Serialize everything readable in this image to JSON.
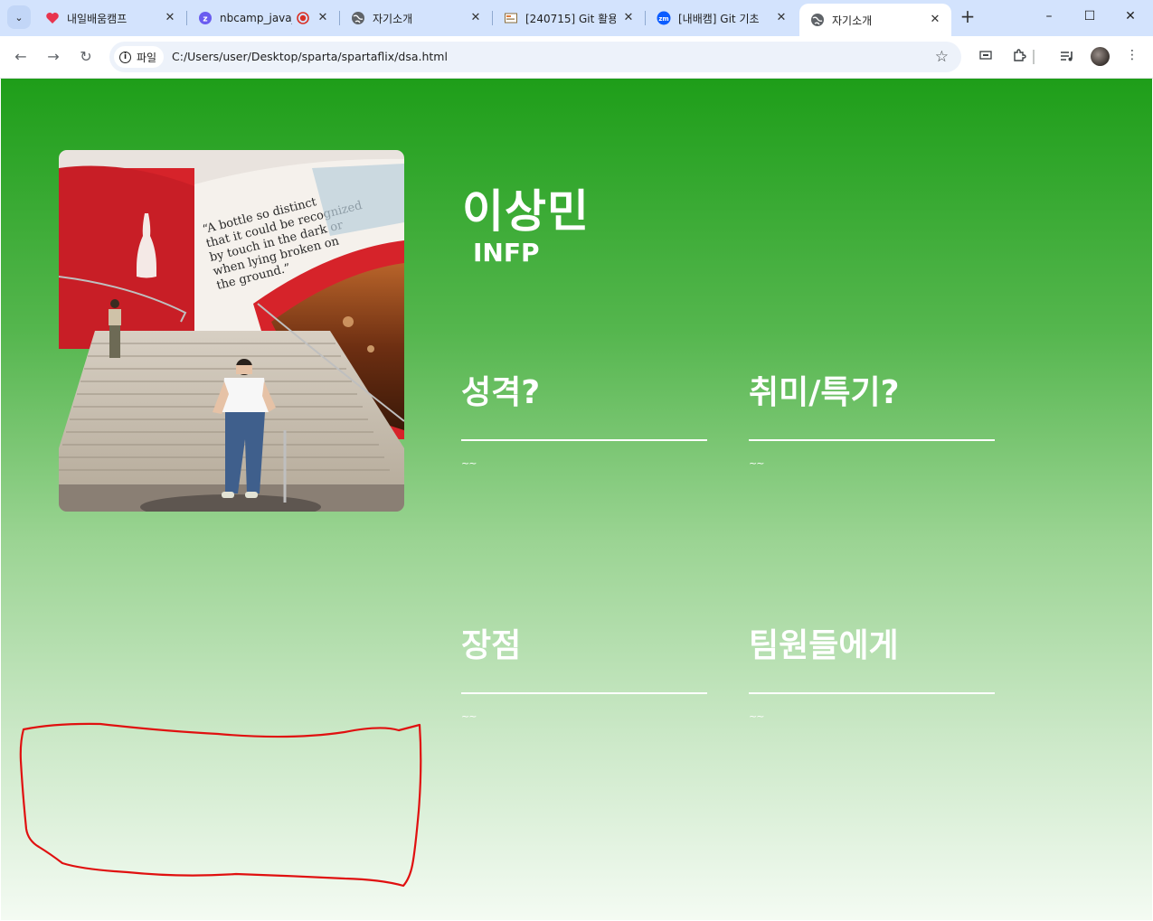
{
  "browser": {
    "tab_search_label": "⌄",
    "tabs": [
      {
        "title": "내일배움캠프",
        "favicon": "heart-icon"
      },
      {
        "title": "nbcamp_java_",
        "favicon": "zep-icon"
      },
      {
        "title": "자기소개",
        "favicon": "globe-icon"
      },
      {
        "title": "[240715] Git 활용",
        "favicon": "notion-icon"
      },
      {
        "title": "[내배캠] Git 기초",
        "favicon": "zoom-icon"
      },
      {
        "title": "자기소개",
        "favicon": "globe-icon",
        "active": true
      }
    ],
    "new_tab_label": "+",
    "window_controls": {
      "minimize": "–",
      "maximize": "☐",
      "close": "✕"
    },
    "address": {
      "chip_label": "파일",
      "url": "C:/Users/user/Desktop/sparta/spartaflix/dsa.html"
    }
  },
  "profile": {
    "name": "이상민",
    "mbti": "INFP"
  },
  "cards": [
    {
      "title": "성격?",
      "body": "~~"
    },
    {
      "title": "취미/특기?",
      "body": "~~"
    },
    {
      "title": "장점",
      "body": "~~"
    },
    {
      "title": "팀원들에게",
      "body": "~~"
    }
  ],
  "colors": {
    "gradient_top": "#1e9e19",
    "gradient_bottom": "#f4fbf3",
    "text": "#ffffff",
    "annotation": "#e01010"
  }
}
